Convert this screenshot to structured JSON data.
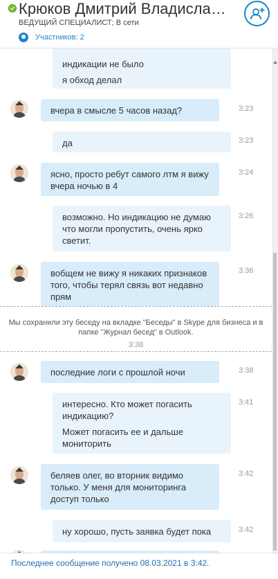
{
  "header": {
    "contact_name": "Крюков Дмитрий Владиславс…",
    "contact_status": "ВЕДУЩИЙ СПЕЦИАЛИСТ;  В сети",
    "participants_label": "Участников: 2",
    "presence_color": "#7dbb38",
    "accent_color": "#1a86c8"
  },
  "messages": [
    {
      "direction": "out",
      "lines": [
        "индикации не было",
        "я обход делал"
      ],
      "time": ""
    },
    {
      "direction": "in",
      "lines": [
        "вчера в смысле 5 часов назад?"
      ],
      "time": "3:23"
    },
    {
      "direction": "out",
      "lines": [
        "да"
      ],
      "time": "3:23"
    },
    {
      "direction": "in",
      "lines": [
        "ясно, просто ребут самого лтм я вижу вчера ночью в 4"
      ],
      "time": "3:24"
    },
    {
      "direction": "out",
      "lines": [
        "возможно. Но индикацию не думаю что могли пропустить, очень ярко светит."
      ],
      "time": "3:26"
    },
    {
      "direction": "in",
      "lines": [
        "вобщем не вижу я никаких признаков того, чтобы терял связь вот недавно прям"
      ],
      "time": "3:36"
    },
    {
      "direction": "in",
      "lines": [
        "последние логи с прошлой ночи"
      ],
      "time": "3:38"
    },
    {
      "direction": "out",
      "lines": [
        "интересно. Кто может погасить индикацию?",
        "Может погасить ее и дальше мониторить"
      ],
      "time": "3:41"
    },
    {
      "direction": "in",
      "lines": [
        "беляев олег, во вторник видимо только. У меня для мониторинга доступ только"
      ],
      "time": "3:42"
    },
    {
      "direction": "out",
      "lines": [
        "ну хорошо, пусть заявка будет пока"
      ],
      "time": "3:42"
    }
  ],
  "notice": {
    "text": "Мы сохранили эту беседу на вкладке \"Беседы\" в Skype для бизнеса и в папке \"Журнал бесед\" в Outlook.",
    "time": "3:38"
  },
  "footer": {
    "last_message": "Последнее сообщение получено 08.03.2021 в 3:42."
  },
  "icons": {
    "presence": "check-circle-icon",
    "participants": "people-icon",
    "add_people": "add-person-icon",
    "avatar": "user-avatar-icon"
  }
}
